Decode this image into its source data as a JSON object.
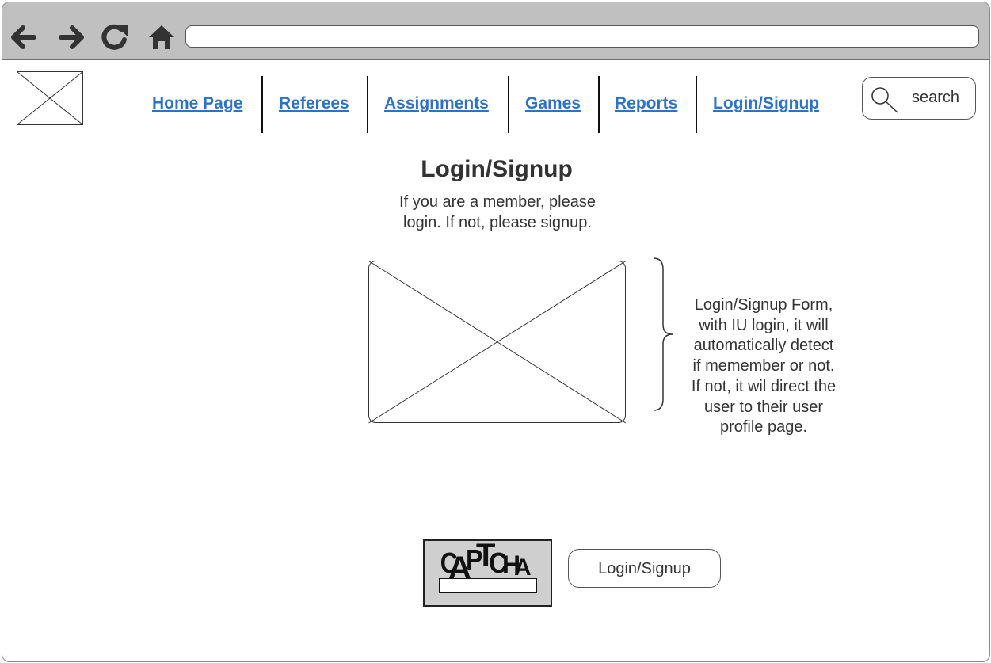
{
  "browser": {
    "address_value": "",
    "icons": [
      "back-arrow-icon",
      "forward-arrow-icon",
      "reload-icon",
      "home-icon"
    ]
  },
  "header": {
    "logo": "image-placeholder-icon",
    "nav": [
      {
        "label": "Home Page"
      },
      {
        "label": "Referees"
      },
      {
        "label": "Assignments"
      },
      {
        "label": "Games"
      },
      {
        "label": "Reports"
      },
      {
        "label": "Login/Signup"
      }
    ],
    "search": {
      "label": "search",
      "icon": "magnifier-icon"
    }
  },
  "main": {
    "title": "Login/Signup",
    "subtitle_lines": [
      "If you are a member, please",
      "login. If not, please signup."
    ],
    "form_placeholder": "image-placeholder-icon",
    "annotation_lines": [
      "Login/Signup Form,",
      "with IU login, it will",
      "automatically detect",
      "if memember or not.",
      "If not, it wil direct the",
      "user to their user",
      "profile page."
    ],
    "captcha_text": "CAPTCHA",
    "captcha_value": "",
    "submit_label": "Login/Signup"
  },
  "colors": {
    "link": "#2d72c4",
    "browser_bar": "#c0c0c0",
    "captcha_bg": "#cfcfcf",
    "text": "#333333"
  }
}
